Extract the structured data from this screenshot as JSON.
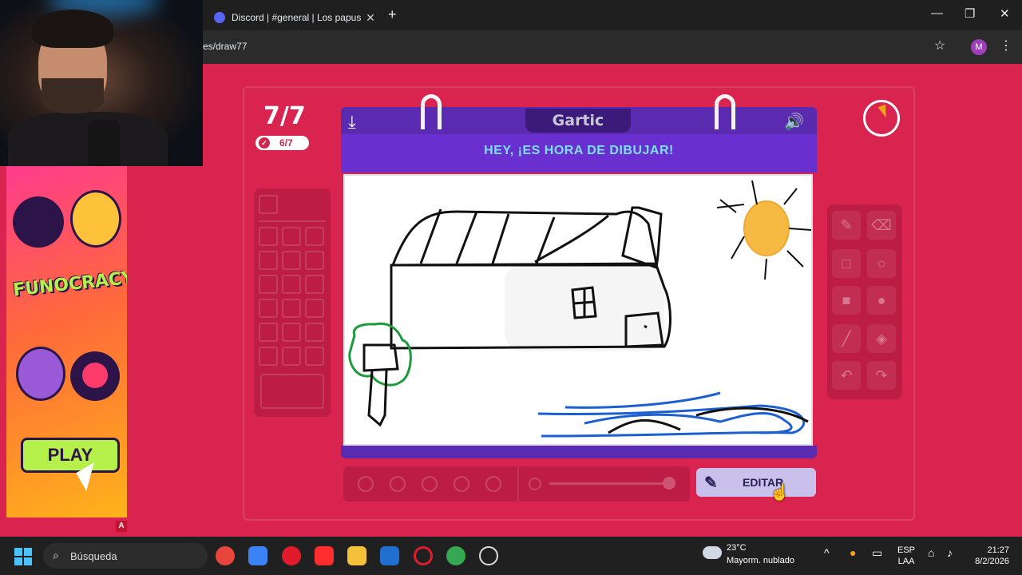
{
  "browser": {
    "tab_title": "Discord | #general | Los papus",
    "url_fragment": "es/draw77",
    "profile_initial": "M"
  },
  "game": {
    "round_current": "7/7",
    "round_done": "6/7",
    "board_title": "HEY, ¡ES HORA DE DIBUJAR!",
    "logo_text": "Gartic",
    "edit_label": "EDITAR"
  },
  "ad": {
    "logo_text": "FUNOCRACY",
    "play_label": "PLAY",
    "badge": "A"
  },
  "taskbar": {
    "search_placeholder": "Búsqueda",
    "weather_temp": "23°C",
    "weather_desc": "Mayorm. nublado",
    "lang_top": "ESP",
    "lang_bottom": "LAA",
    "time": "21:27",
    "date": "8/2/2026"
  },
  "colors": {
    "background": "#d9244f",
    "board": "#5a2bb1",
    "title": "#7be0f0",
    "edit_button": "#c9c0ec",
    "timer_wedge": "#f4a21a"
  }
}
